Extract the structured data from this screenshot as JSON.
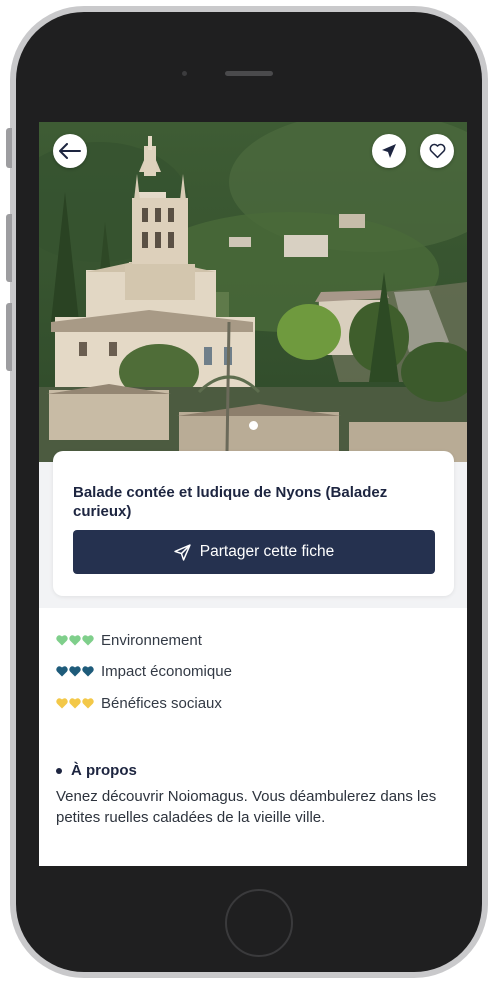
{
  "listing": {
    "title": "Balade contée et ludique de Nyons (Baladez curieux)",
    "share_label": "Partager cette fiche"
  },
  "impact": [
    {
      "label": "Environnement",
      "color": "#7fcf8b",
      "hearts": 3
    },
    {
      "label": "Impact économique",
      "color": "#1e5b7a",
      "hearts": 3
    },
    {
      "label": "Bénéfices sociaux",
      "color": "#f3c848",
      "hearts": 3
    }
  ],
  "about": {
    "title": "À propos",
    "text": "Venez découvrir Noiomagus. Vous déambulerez dans les petites ruelles caladées de la vieille ville."
  },
  "icons": {
    "back": "arrow-left-icon",
    "share": "send-icon",
    "favorite": "heart-outline-icon"
  },
  "colors": {
    "primary": "#25314f",
    "title": "#1d2540",
    "background_band": "#f2f3f5"
  }
}
